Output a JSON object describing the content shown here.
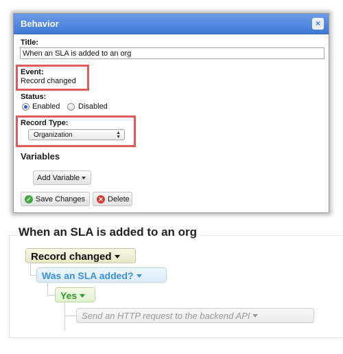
{
  "dialog": {
    "title": "Behavior",
    "close_glyph": "×",
    "title_label": "Title:",
    "title_value": "When an SLA is added to an org",
    "event_label": "Event:",
    "event_value": "Record changed",
    "status_label": "Status:",
    "status_enabled": "Enabled",
    "status_disabled": "Disabled",
    "status_selected": "Enabled",
    "record_type_label": "Record Type:",
    "record_type_value": "Organization",
    "variables_heading": "Variables",
    "add_variable_label": "Add Variable",
    "save_label": "Save Changes",
    "delete_label": "Delete"
  },
  "workflow": {
    "title": "When an SLA is added to an org",
    "event_node": "Record changed",
    "condition_node": "Was an SLA added?",
    "branch_node": "Yes",
    "action_node": "Send an HTTP request to the backend API"
  },
  "colors": {
    "header_blue": "#3f78d6",
    "highlight_red": "#e05a5a",
    "condition_blue": "#3d8edb",
    "branch_green": "#2e9a2e",
    "action_gray": "#9a9a9a"
  },
  "icons": {
    "close": "close-icon",
    "save": "check-circle-icon",
    "delete": "x-circle-icon",
    "dropdown": "caret-down-icon"
  }
}
